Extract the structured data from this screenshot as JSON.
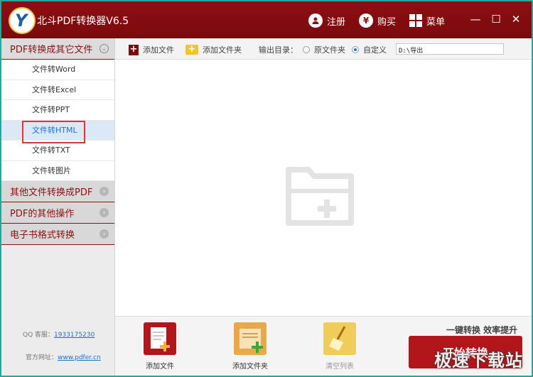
{
  "app": {
    "title": "北斗PDF转换器V6.5"
  },
  "titlebar": {
    "register_label": "注册",
    "buy_label": "购买",
    "menu_label": "菜单",
    "minimize_glyph": "—",
    "maximize_glyph": "☐",
    "close_glyph": "✕",
    "logo_letter": "Y"
  },
  "sidebar": {
    "sections": [
      {
        "label": "PDF转换成其它文件",
        "expanded": true
      },
      {
        "label": "其他文件转换成PDF",
        "expanded": false
      },
      {
        "label": "PDF的其他操作",
        "expanded": false
      },
      {
        "label": "电子书格式转换",
        "expanded": false
      }
    ],
    "items": [
      {
        "label": "文件转Word"
      },
      {
        "label": "文件转Excel"
      },
      {
        "label": "文件转PPT"
      },
      {
        "label": "文件转HTML"
      },
      {
        "label": "文件转TXT"
      },
      {
        "label": "文件转图片"
      }
    ],
    "selected_item": "文件转HTML",
    "footer": {
      "qq_label": "QQ 客服：",
      "qq_number": "1933175230",
      "site_label": "官方网址：",
      "site_url": "www.pdfer.cn"
    }
  },
  "toolbar": {
    "add_file_label": "添加文件",
    "add_folder_label": "添加文件夹",
    "output_dir_label": "输出目录：",
    "radio_original_label": "原文件夹",
    "radio_custom_label": "自定义",
    "selected_output": "自定义",
    "output_path": "D:\\导出"
  },
  "bottom": {
    "add_file_label": "添加文件",
    "add_folder_label": "添加文件夹",
    "clear_label": "清空列表",
    "slogan": "一键转换  效率提升",
    "start_label": "开始转换"
  },
  "watermark": {
    "text": "极速下载站"
  },
  "colors": {
    "brand_red": "#8c0f12",
    "accent_blue": "#1e6fd0",
    "highlight_box": "#d23a3a",
    "background_teal": "#2aa59a"
  }
}
